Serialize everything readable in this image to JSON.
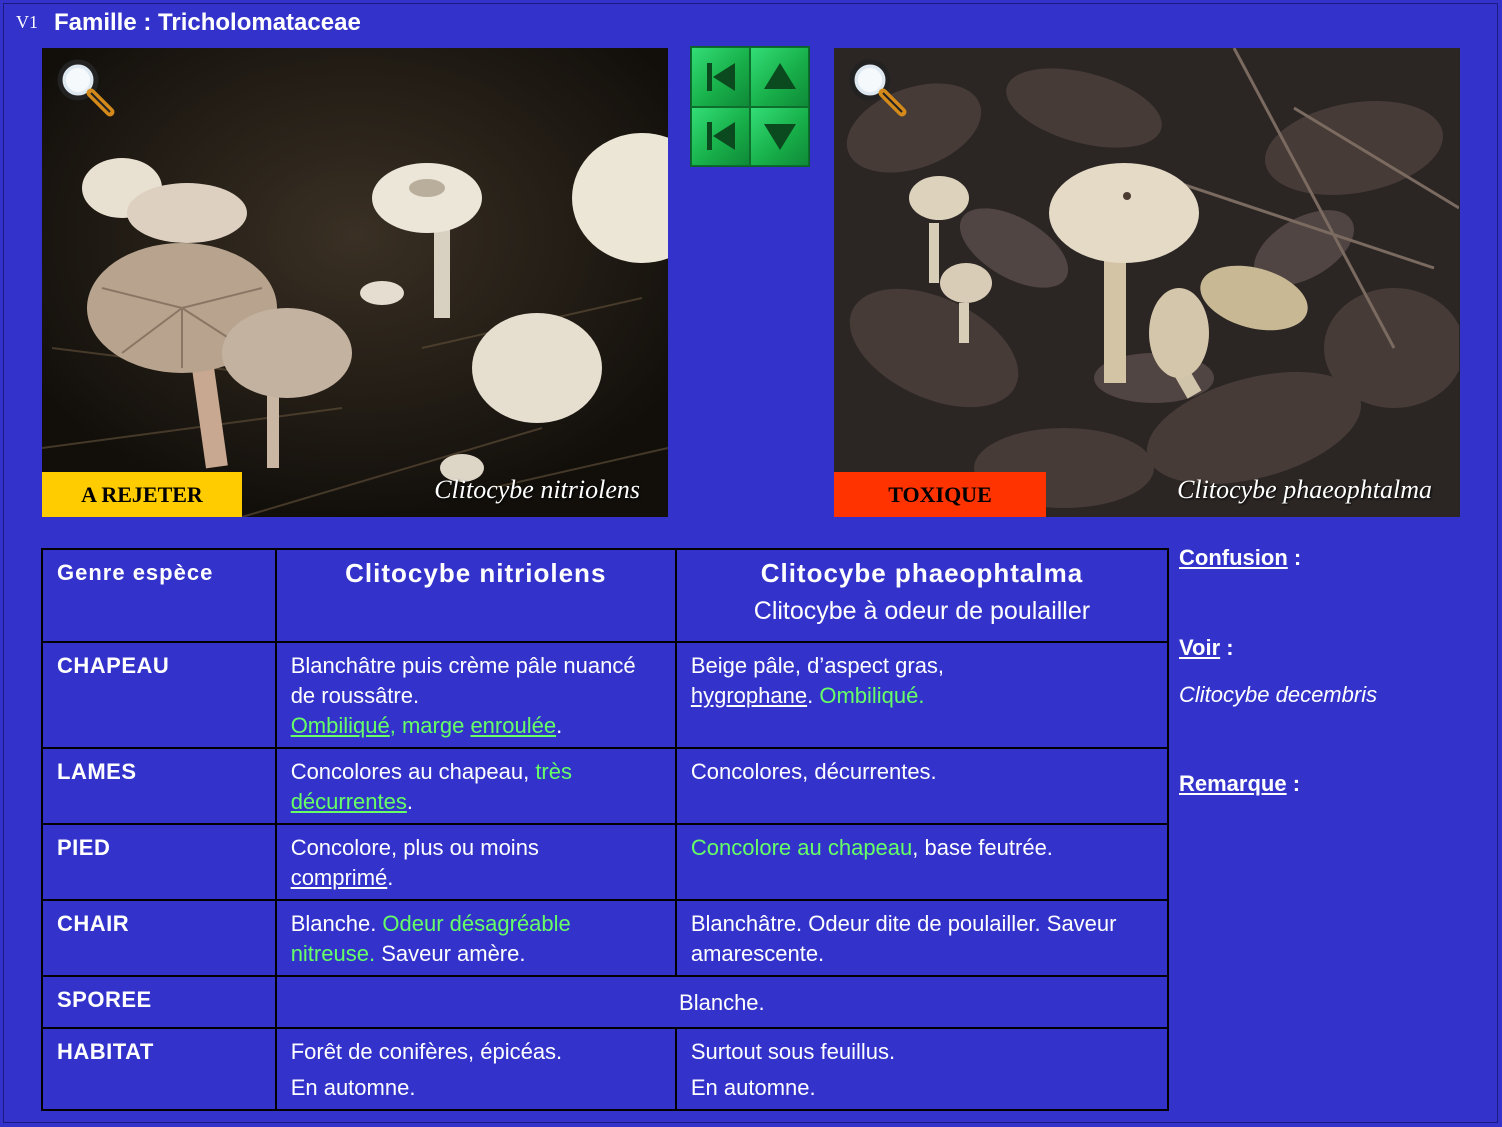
{
  "header": {
    "version": "V1",
    "family": "Famille : Tricholomataceae"
  },
  "photos": {
    "left": {
      "badge": "A REJETER",
      "caption": "Clitocybe nitriolens",
      "badge_color": "#ffcc00"
    },
    "right": {
      "badge": "TOXIQUE",
      "caption": "Clitocybe phaeophtalma",
      "badge_color": "#ff3300"
    }
  },
  "nav": {
    "buttons": [
      "first-icon",
      "up-icon",
      "previous-icon",
      "down-icon"
    ]
  },
  "table": {
    "genre_label": "Genre espèce",
    "species1": {
      "name": "Clitocybe nitriolens"
    },
    "species2": {
      "name": "Clitocybe phaeophtalma",
      "common": "Clitocybe à odeur de poulailler"
    },
    "rows": {
      "chapeau": {
        "label": "CHAPEAU",
        "s1": {
          "t1": "Blanchâtre puis crème pâle nuancé de roussâtre.",
          "t2": "Ombiliqué",
          "t3": ", marge ",
          "t4": "enroulée",
          "t5": "."
        },
        "s2": {
          "t1": "Beige pâle, d’aspect gras, ",
          "t2": "hygrophane",
          "t3": ". ",
          "t4": "Ombiliqué."
        }
      },
      "lames": {
        "label": "LAMES",
        "s1": {
          "t1": "Concolores au chapeau, ",
          "t2": "très ",
          "t3": "décurrentes",
          "t4": "."
        },
        "s2": {
          "t1": "Concolores, décurrentes."
        }
      },
      "pied": {
        "label": "PIED",
        "s1": {
          "t1": "Concolore, plus ou moins ",
          "t2": "comprimé",
          "t3": "."
        },
        "s2": {
          "t1": "Concolore au chapeau",
          "t2": ", base feutrée."
        }
      },
      "chair": {
        "label": "CHAIR",
        "s1": {
          "t1": "Blanche. ",
          "t2": "Odeur désagréable nitreuse.",
          "t3": " Saveur amère."
        },
        "s2": {
          "t1": "Blanchâtre. Odeur dite de poulailler. Saveur amarescente."
        }
      },
      "sporee": {
        "label": "SPOREE",
        "both": "Blanche."
      },
      "habitat": {
        "label": "HABITAT",
        "s1": {
          "line1": "Forêt de conifères, épicéas.",
          "line2": "En automne."
        },
        "s2": {
          "line1": "Surtout sous feuillus.",
          "line2": "En automne."
        }
      }
    }
  },
  "side": {
    "confusion_label": "Confusion",
    "voir_label": "Voir",
    "voir_item": "Clitocybe decembris",
    "remarque_label": "Remarque",
    "colon": " :"
  },
  "colors": {
    "background": "#3333cc",
    "highlight_green": "#66ff66",
    "nav_green": "#22c55e"
  }
}
